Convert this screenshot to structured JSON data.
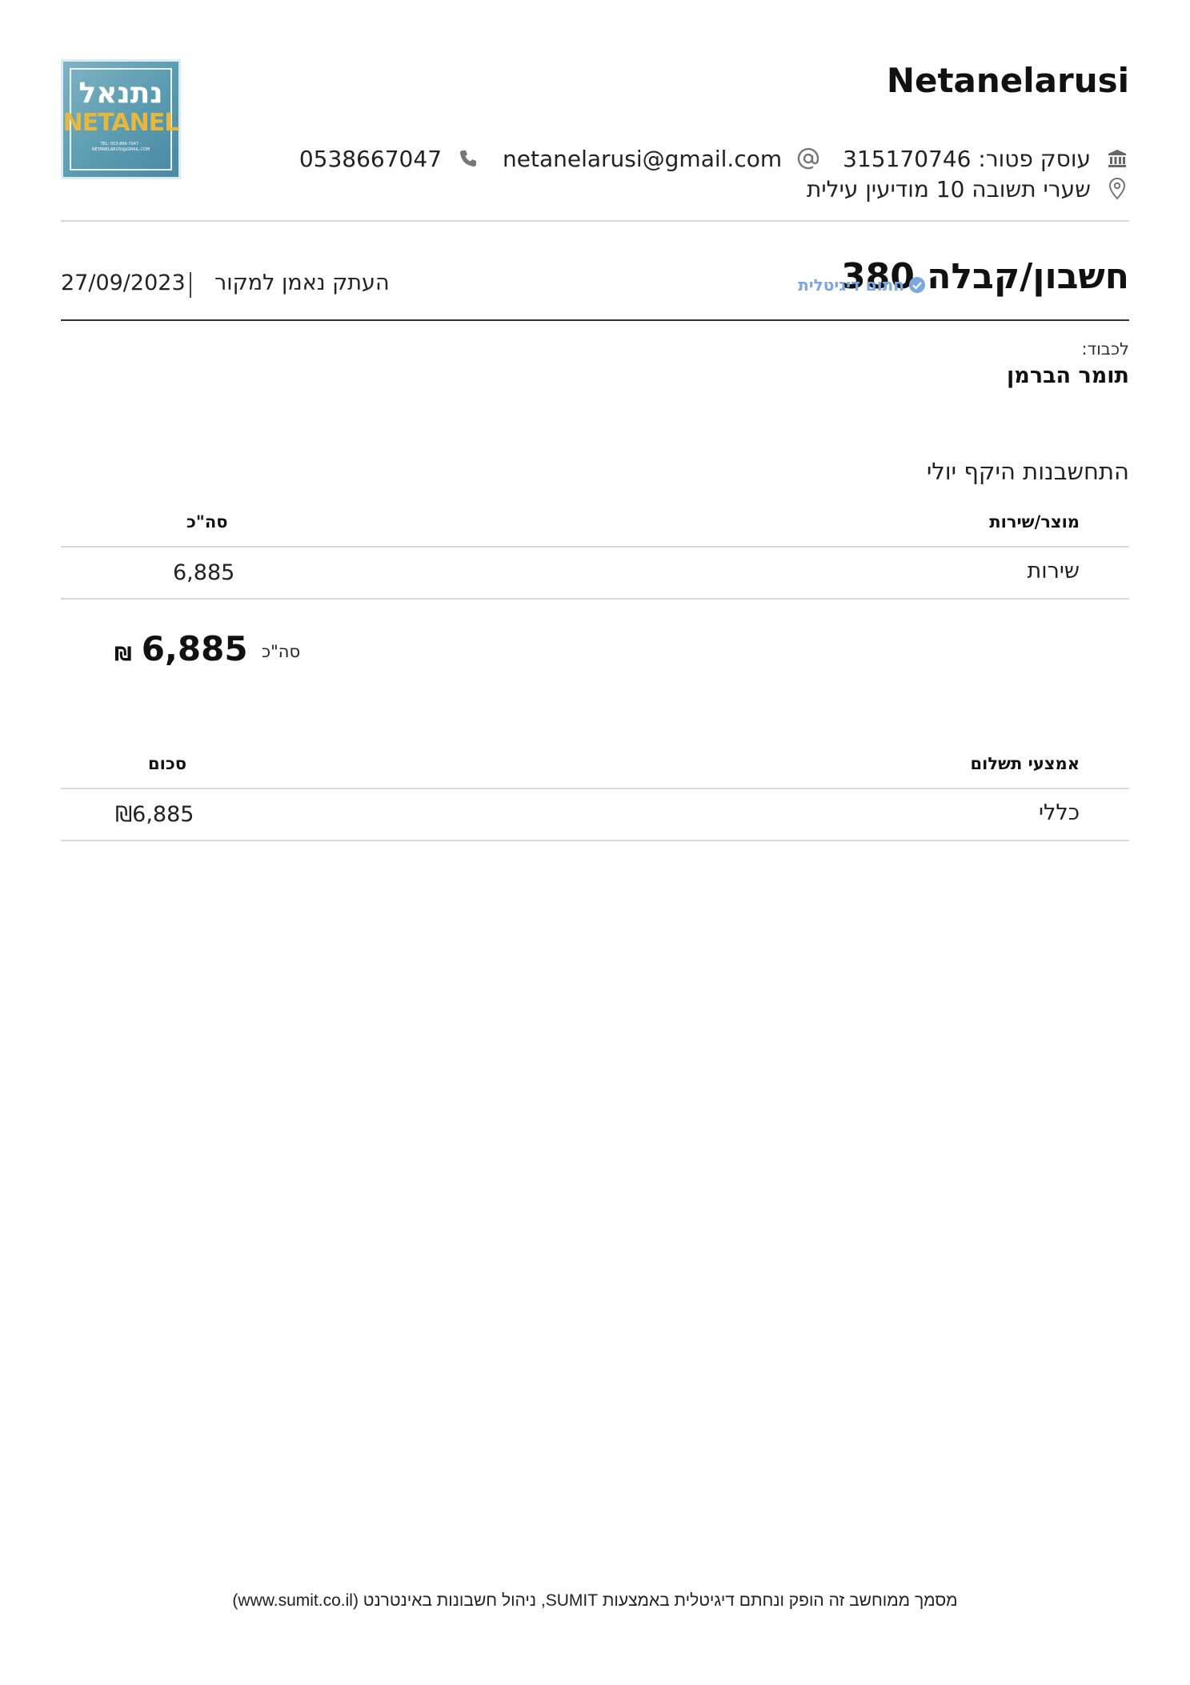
{
  "header": {
    "business_name": "Netanelarusi",
    "logo": {
      "hebrew_text": "נתנאל",
      "english_text": "NETANEL",
      "small_text": "TEL: 053-866-7047 · NETANELARUSI@GMAIL.COM"
    },
    "tax_id": "עוסק פטור: 315170746",
    "email": "netanelarusi@gmail.com",
    "phone": "0538667047",
    "address": "שערי תשובה 10 מודיעין עילית",
    "icons": {
      "bank": "bank-icon",
      "at": "at-sign-icon",
      "phone": "phone-icon",
      "location": "location-pin-icon"
    }
  },
  "document": {
    "title": "חשבון/קבלה 380",
    "signed_label": "חתום דיגיטלית",
    "copy_label": "העתק נאמן למקור",
    "date": "27/09/2023"
  },
  "recipient": {
    "label": "לכבוד:",
    "name": "תומר הברמן"
  },
  "description": "התחשבנות היקף יולי",
  "items_table": {
    "headers": {
      "product": "מוצר/שירות",
      "total": "סה\"כ"
    },
    "rows": [
      {
        "product": "שירות",
        "total": "6,885"
      }
    ]
  },
  "summary": {
    "label": "סה\"כ",
    "amount": "6,885",
    "currency": "₪"
  },
  "payments_table": {
    "headers": {
      "method": "אמצעי תשלום",
      "amount": "סכום"
    },
    "rows": [
      {
        "method": "כללי",
        "amount": "₪6,885"
      }
    ]
  },
  "footer": {
    "text": "מסמך ממוחשב זה הופק ונחתם דיגיטלית באמצעות SUMIT, ניהול חשבונות באינטרנט (www.sumit.co.il)"
  },
  "colors": {
    "accent_signed": "#7da7dd",
    "text": "#1c1c1c",
    "divider": "#d9d9d9"
  }
}
